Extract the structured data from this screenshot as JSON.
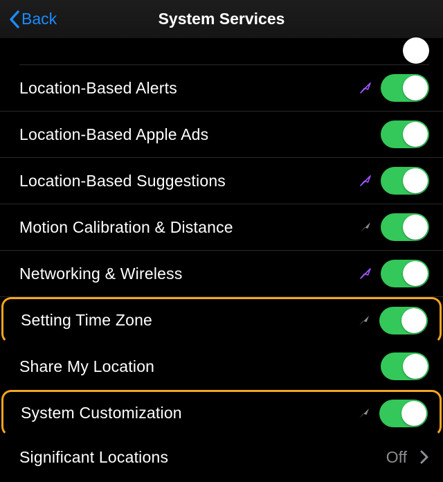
{
  "nav": {
    "back": "Back",
    "title": "System Services"
  },
  "items": [
    {
      "label": "Location-Based Alerts",
      "indicator": "purple-outline",
      "toggle": true,
      "highlighted": false
    },
    {
      "label": "Location-Based Apple Ads",
      "indicator": "none",
      "toggle": true,
      "highlighted": false
    },
    {
      "label": "Location-Based Suggestions",
      "indicator": "purple-outline",
      "toggle": true,
      "highlighted": false
    },
    {
      "label": "Motion Calibration & Distance",
      "indicator": "gray-solid",
      "toggle": true,
      "highlighted": false
    },
    {
      "label": "Networking & Wireless",
      "indicator": "purple-outline",
      "toggle": true,
      "highlighted": false
    },
    {
      "label": "Setting Time Zone",
      "indicator": "gray-solid",
      "toggle": true,
      "highlighted": true
    },
    {
      "label": "Share My Location",
      "indicator": "none",
      "toggle": true,
      "highlighted": false
    },
    {
      "label": "System Customization",
      "indicator": "gray-solid",
      "toggle": true,
      "highlighted": true
    }
  ],
  "link_row": {
    "label": "Significant Locations",
    "value": "Off"
  },
  "colors": {
    "toggle_on": "#34c759",
    "highlight": "#f5a623",
    "indicator_purple": "#a259ff",
    "indicator_gray": "#8e8e93",
    "link": "#1a8cff"
  }
}
